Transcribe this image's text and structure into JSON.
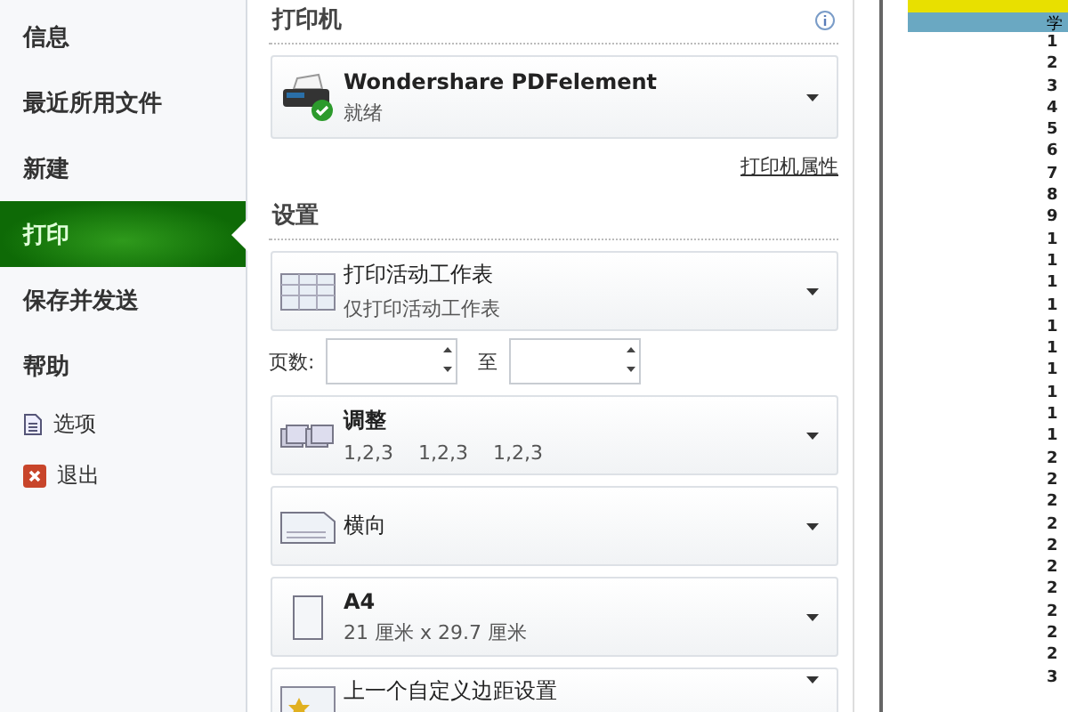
{
  "sidebar": {
    "items": [
      {
        "label": "信息",
        "kind": "text",
        "selected": false
      },
      {
        "label": "最近所用文件",
        "kind": "text",
        "selected": false
      },
      {
        "label": "新建",
        "kind": "text",
        "selected": false
      },
      {
        "label": "打印",
        "kind": "text",
        "selected": true
      },
      {
        "label": "保存并发送",
        "kind": "text",
        "selected": false
      },
      {
        "label": "帮助",
        "kind": "text",
        "selected": false
      },
      {
        "label": "选项",
        "kind": "options",
        "selected": false
      },
      {
        "label": "退出",
        "kind": "exit",
        "selected": false
      }
    ]
  },
  "printer": {
    "heading": "打印机",
    "name": "Wondershare PDFelement",
    "status": "就绪",
    "properties_link": "打印机属性"
  },
  "settings": {
    "heading": "设置",
    "dropdowns": [
      {
        "kind": "sheet",
        "title": "打印活动工作表",
        "subtitle": "仅打印活动工作表"
      }
    ],
    "pages": {
      "label": "页数:",
      "to": "至"
    },
    "more": [
      {
        "kind": "collate",
        "title": "调整",
        "subtitle": "1,2,3    1,2,3    1,2,3"
      },
      {
        "kind": "orientation",
        "title": "横向"
      },
      {
        "kind": "paper",
        "title": "A4",
        "subtitle": "21 厘米 x 29.7 厘米"
      },
      {
        "kind": "margins",
        "title": "上一个自定义边距设置"
      }
    ]
  },
  "preview": {
    "header": "学",
    "rows": [
      "1",
      "2",
      "3",
      "4",
      "5",
      "6",
      "7",
      "8",
      "9",
      "1",
      "1",
      "1",
      "1",
      "1",
      "1",
      "1",
      "1",
      "1",
      "1",
      "2",
      "2",
      "2",
      "2",
      "2",
      "2",
      "2",
      "2",
      "2",
      "2",
      "3"
    ]
  }
}
